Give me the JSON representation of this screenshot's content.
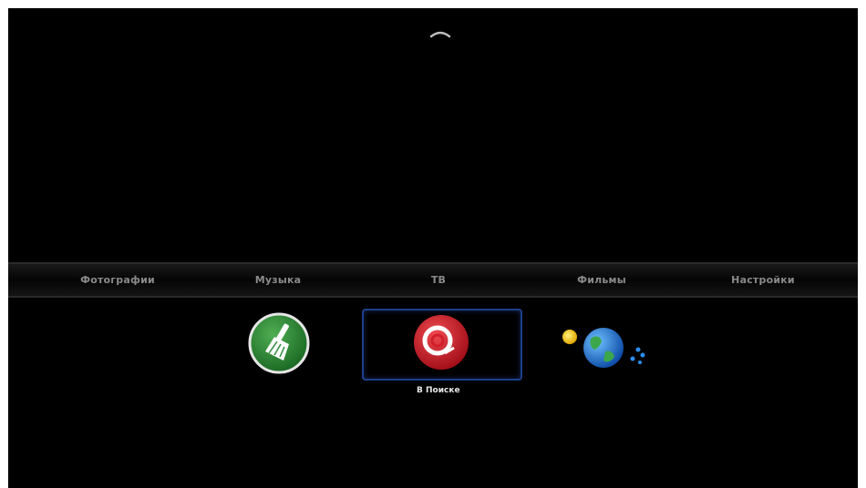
{
  "menu": {
    "items": [
      {
        "label": "Фотографии"
      },
      {
        "label": "Музыка"
      },
      {
        "label": "ТВ"
      },
      {
        "label": "Фильмы"
      },
      {
        "label": "Настройки"
      }
    ]
  },
  "apps": [
    {
      "icon": "broom-cleaner-icon",
      "label": ""
    },
    {
      "icon": "v-poiske-icon",
      "label": "В Поиске",
      "focused": true
    },
    {
      "icon": "globe-planet-icon",
      "label": ""
    }
  ],
  "colors": {
    "background": "#000000",
    "focus_border": "#1e3f8a",
    "cleaner_green": "#2e8b3a",
    "search_red": "#d21f2b",
    "globe_blue": "#1f6fd0"
  }
}
